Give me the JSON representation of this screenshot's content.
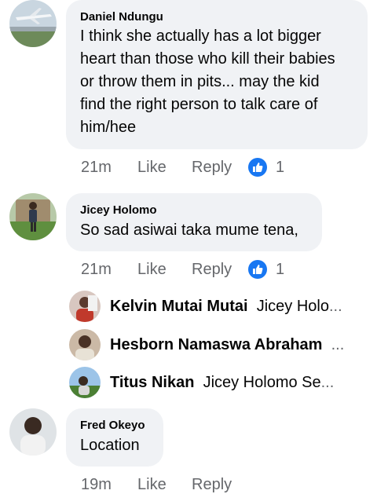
{
  "comments": [
    {
      "author": "Daniel Ndungu",
      "text_lines": [
        "I think she actually has a lot bigger",
        "heart than those who kill their babies",
        "or throw them in pits... may the kid",
        "find the right person to talk care of",
        "him/hee"
      ],
      "time": "21m",
      "like_label": "Like",
      "reply_label": "Reply",
      "reaction_count": "1"
    },
    {
      "author": "Jicey Holomo",
      "text_lines": [
        "So sad asiwai taka mume tena,"
      ],
      "time": "21m",
      "like_label": "Like",
      "reply_label": "Reply",
      "reaction_count": "1"
    },
    {
      "author": "Fred Okeyo",
      "text_lines": [
        "Location"
      ],
      "time": "19m",
      "like_label": "Like",
      "reply_label": "Reply"
    }
  ],
  "replies": [
    {
      "name": "Kelvin Mutai Mutai",
      "preview": "Jicey Holo",
      "ellipsis": "..."
    },
    {
      "name": "Hesborn Namaswa Abraham",
      "preview": "",
      "ellipsis": "..."
    },
    {
      "name": "Titus Nikan",
      "preview": "Jicey Holomo Se",
      "ellipsis": "..."
    }
  ],
  "colors": {
    "accent": "#1877f2",
    "bubble": "#f0f2f5",
    "muted": "#65676b"
  },
  "icons": {
    "reaction": "like-thumbs-up-icon"
  }
}
